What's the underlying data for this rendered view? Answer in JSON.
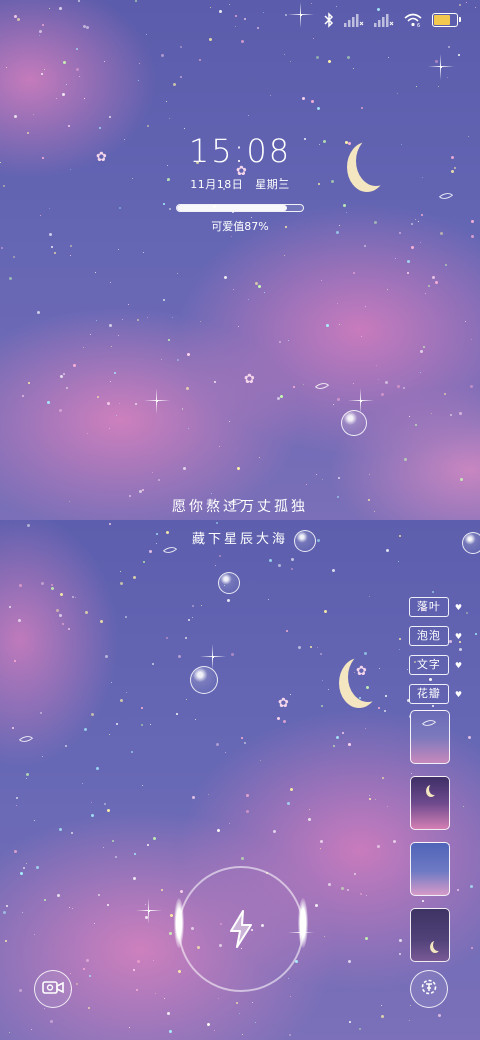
{
  "status_bar": {
    "icons": [
      "bluetooth-icon",
      "signal-1-icon",
      "signal-2-icon",
      "wifi-icon",
      "battery-charging-icon"
    ],
    "battery_level": 0.75,
    "battery_color": "#f3c84e"
  },
  "lock": {
    "time": "15:08",
    "date": "11月18日",
    "weekday": "星期三",
    "cute_value_label": "可爱值87%",
    "cute_value": 0.87
  },
  "quotes": {
    "line1": "愿你熬过万丈孤独",
    "line2": "藏下星辰大海"
  },
  "effects_menu": {
    "items": [
      {
        "label": "落叶"
      },
      {
        "label": "泡泡"
      },
      {
        "label": "文字"
      },
      {
        "label": "花瓣"
      }
    ],
    "thumbnails": [
      "wallpaper-thumb-1",
      "wallpaper-thumb-2",
      "wallpaper-thumb-3",
      "wallpaper-thumb-4"
    ]
  },
  "bottom_controls": {
    "camera_icon": "camera-icon",
    "charge_icon": "lightning-bolt-icon",
    "settings_icon": "theme-settings-icon"
  },
  "colors": {
    "sky": "#5f60ad",
    "cloud_pink": "#d680be",
    "moon": "#f4e6c0"
  }
}
